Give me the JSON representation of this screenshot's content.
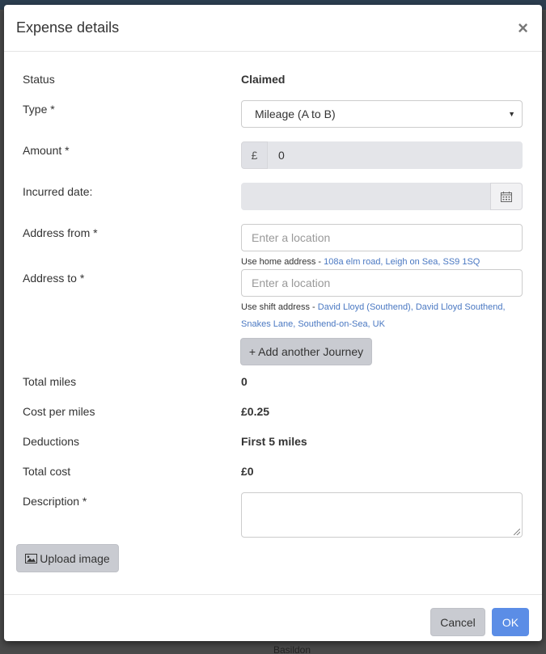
{
  "backdrop": {
    "footer_text": "Basildon"
  },
  "modal": {
    "title": "Expense details",
    "close_label": "×"
  },
  "form": {
    "status": {
      "label": "Status",
      "value": "Claimed"
    },
    "type": {
      "label": "Type *",
      "value": "Mileage (A to B)"
    },
    "amount": {
      "label": "Amount *",
      "currency": "£",
      "value": "0"
    },
    "incurred_date": {
      "label": "Incurred date:",
      "value": ""
    },
    "address_from": {
      "label": "Address from *",
      "placeholder": "Enter a location",
      "hint_prefix": "Use home address - ",
      "hint_link": "108a elm road, Leigh on Sea, SS9 1SQ"
    },
    "address_to": {
      "label": "Address to *",
      "placeholder": "Enter a location",
      "hint_prefix": "Use shift address - ",
      "hint_link": "David Lloyd (Southend), David Lloyd Southend, Snakes Lane, Southend-on-Sea, UK"
    },
    "add_journey_label": "+ Add another Journey",
    "total_miles": {
      "label": "Total miles",
      "value": "0"
    },
    "cost_per_miles": {
      "label": "Cost per miles",
      "value": "£0.25"
    },
    "deductions": {
      "label": "Deductions",
      "value": "First 5 miles"
    },
    "total_cost": {
      "label": "Total cost",
      "value": "£0"
    },
    "description": {
      "label": "Description *",
      "value": ""
    },
    "upload_label": "Upload image"
  },
  "footer": {
    "cancel_label": "Cancel",
    "ok_label": "OK"
  },
  "colors": {
    "primary": "#5b8de6",
    "link": "#4a78c2",
    "grey_button": "#c9cbd1"
  }
}
